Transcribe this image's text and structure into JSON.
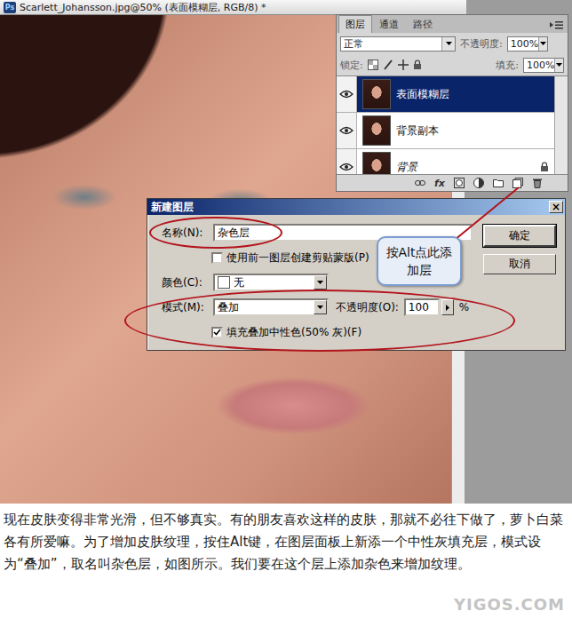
{
  "document": {
    "app_icon": "Ps",
    "title": "Scarlett_Johansson.jpg@50% (表面模糊层, RGB/8) *"
  },
  "layers_panel": {
    "tabs": [
      {
        "label": "图层",
        "selected": true
      },
      {
        "label": "通道",
        "selected": false
      },
      {
        "label": "路径",
        "selected": false
      }
    ],
    "blend_mode": "正常",
    "opacity_label": "不透明度:",
    "opacity": "100%",
    "lock_label": "锁定:",
    "fill_label": "填充:",
    "fill": "100%",
    "layers": [
      {
        "name": "表面模糊层",
        "selected": true,
        "visible": true,
        "locked": false,
        "italic": false
      },
      {
        "name": "背景副本",
        "selected": false,
        "visible": true,
        "locked": false,
        "italic": false
      },
      {
        "name": "背景",
        "selected": false,
        "visible": true,
        "locked": true,
        "italic": true
      }
    ],
    "fx_label": "fx"
  },
  "dialog": {
    "title": "新建图层",
    "close": "×",
    "name_label": "名称(N):",
    "name_value": "杂色层",
    "clip_checkbox": {
      "label": "使用前一图层创建剪贴蒙版(P)",
      "checked": false
    },
    "color_label": "颜色(C):",
    "color_value": "无",
    "mode_label": "模式(M):",
    "mode_value": "叠加",
    "opacity_label": "不透明度(O):",
    "opacity_value": "100",
    "opacity_unit": "%",
    "fill_checkbox": {
      "label": "填充叠加中性色(50% 灰)(F)",
      "checked": true
    },
    "buttons": [
      "确定",
      "取消"
    ]
  },
  "callout": {
    "text": "按Alt点此添加层"
  },
  "caption": "现在皮肤变得非常光滑，但不够真实。有的朋友喜欢这样的皮肤，那就不必往下做了，萝卜白菜各有所爱嘛。为了增加皮肤纹理，按住Alt键，在图层面板上新添一个中性灰填充层，模式设为“叠加”，取名叫杂色层，如图所示。我们要在这个层上添加杂色来增加纹理。",
  "watermark": "YIGOS.COM"
}
